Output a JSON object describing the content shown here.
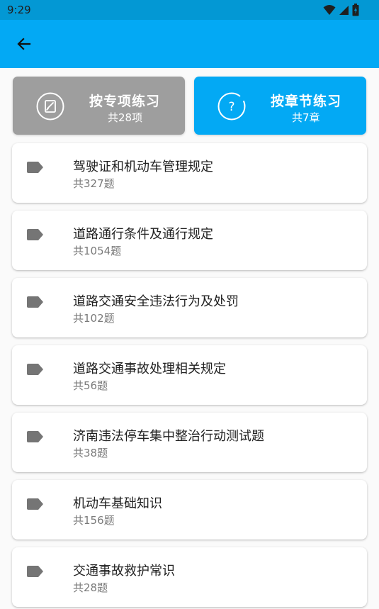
{
  "status_bar": {
    "time": "9:29",
    "icons": [
      "wifi-icon",
      "signal-icon",
      "battery-icon"
    ]
  },
  "app_bar": {
    "back_icon": "arrow-left-icon",
    "color": "#03a9f4"
  },
  "modes": [
    {
      "title": "按专项练习",
      "subtitle": "共28项",
      "icon": "edit-note-icon",
      "color": "#9e9e9e",
      "selected": false
    },
    {
      "title": "按章节练习",
      "subtitle": "共7章",
      "icon": "question-icon",
      "color": "#03a9f4",
      "selected": true
    }
  ],
  "items": [
    {
      "title": "驾驶证和机动车管理规定",
      "count": "共327题"
    },
    {
      "title": "道路通行条件及通行规定",
      "count": "共1054题"
    },
    {
      "title": "道路交通安全违法行为及处罚",
      "count": "共102题"
    },
    {
      "title": "道路交通事故处理相关规定",
      "count": "共56题"
    },
    {
      "title": "济南违法停车集中整治行动测试题",
      "count": "共38题"
    },
    {
      "title": "机动车基础知识",
      "count": "共156题"
    },
    {
      "title": "交通事故救护常识",
      "count": "共28题"
    }
  ],
  "list_icon": "label-tag-icon"
}
